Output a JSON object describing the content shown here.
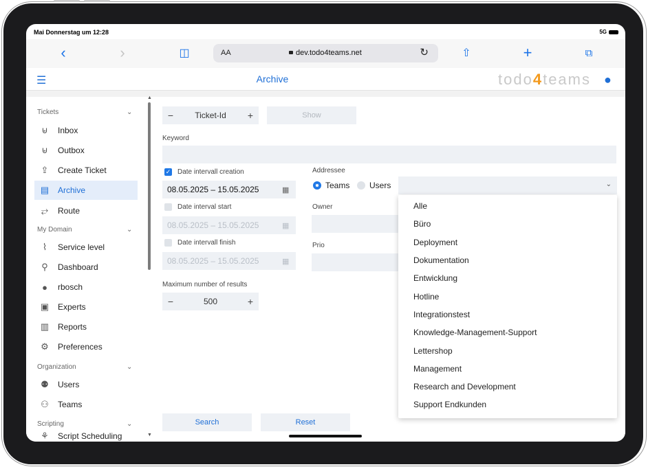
{
  "status": {
    "time": "Mai Donnerstag um 12:28",
    "signal": "5G"
  },
  "browser": {
    "aa": "AA",
    "url": "dev.todo4teams.net"
  },
  "app": {
    "title": "Archive",
    "brand_a": "todo",
    "brand_b": "4",
    "brand_c": "teams"
  },
  "sidebar": {
    "section_tickets": "Tickets",
    "section_domain": "My Domain",
    "section_org": "Organization",
    "section_scripting": "Scripting",
    "items": [
      {
        "label": "Inbox",
        "icon": "inbox-icon",
        "glyph": "⊌"
      },
      {
        "label": "Outbox",
        "icon": "outbox-icon",
        "glyph": "⊌"
      },
      {
        "label": "Create Ticket",
        "icon": "upload-icon",
        "glyph": "⇪"
      },
      {
        "label": "Archive",
        "icon": "archive-icon",
        "glyph": "▤"
      },
      {
        "label": "Route",
        "icon": "route-icon",
        "glyph": "⥂"
      },
      {
        "label": "Service level",
        "icon": "pulse-icon",
        "glyph": "⌇"
      },
      {
        "label": "Dashboard",
        "icon": "dashboard-icon",
        "glyph": "⚲"
      },
      {
        "label": "rbosch",
        "icon": "user-icon",
        "glyph": "●"
      },
      {
        "label": "Experts",
        "icon": "experts-icon",
        "glyph": "▣"
      },
      {
        "label": "Reports",
        "icon": "reports-icon",
        "glyph": "▥"
      },
      {
        "label": "Preferences",
        "icon": "gear-icon",
        "glyph": "⚙"
      },
      {
        "label": "Users",
        "icon": "users-icon",
        "glyph": "⚉"
      },
      {
        "label": "Teams",
        "icon": "teams-icon",
        "glyph": "⚇"
      },
      {
        "label": "Script Scheduling",
        "icon": "schedule-icon",
        "glyph": "⚘"
      }
    ]
  },
  "form": {
    "ticket_id_label": "Ticket-Id",
    "show_label": "Show",
    "keyword_label": "Keyword",
    "date_creation_label": "Date intervall creation",
    "date_creation_value": "08.05.2025  –  15.05.2025",
    "date_start_label": "Date interval start",
    "date_start_value": "08.05.2025  –  15.05.2025",
    "date_finish_label": "Date intervall finish",
    "date_finish_value": "08.05.2025  –  15.05.2025",
    "max_results_label": "Maximum number of results",
    "max_results_value": "500",
    "addressee_label": "Addressee",
    "radio_teams": "Teams",
    "radio_users": "Users",
    "owner_label": "Owner",
    "prio_label": "Prio",
    "search_label": "Search",
    "reset_label": "Reset"
  },
  "dropdown": [
    "Alle",
    "Büro",
    "Deployment",
    "Dokumentation",
    "Entwicklung",
    "Hotline",
    "Integrationstest",
    "Knowledge-Management-Support",
    "Lettershop",
    "Management",
    "Research and Development",
    "Support Endkunden"
  ],
  "colors": {
    "accent": "#1f6fd6",
    "brand4": "#f39a1e",
    "field": "#eef1f5"
  }
}
